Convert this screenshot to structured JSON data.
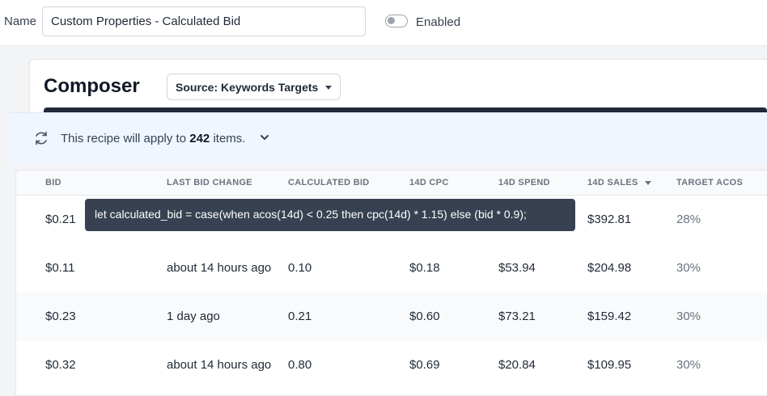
{
  "header": {
    "name_label": "Name",
    "name_value": "Custom Properties - Calculated Bid",
    "enabled_label": "Enabled",
    "enabled": false
  },
  "composer": {
    "title": "Composer",
    "source_label": "Source: Keywords Targets"
  },
  "banner": {
    "prefix": "This recipe will apply to",
    "count": "242",
    "suffix": "items."
  },
  "table": {
    "columns": [
      "BID",
      "LAST BID CHANGE",
      "CALCULATED BID",
      "14D CPC",
      "14D SPEND",
      "14D SALES",
      "TARGET ACOS"
    ],
    "sorted_column": "14D SALES",
    "rows": [
      {
        "bid": "$0.21",
        "last_change": "",
        "calc_bid": "",
        "cpc": "",
        "spend": "",
        "sales": "$392.81",
        "acos": "28%"
      },
      {
        "bid": "$0.11",
        "last_change": "about 14 hours ago",
        "calc_bid": "0.10",
        "cpc": "$0.18",
        "spend": "$53.94",
        "sales": "$204.98",
        "acos": "30%"
      },
      {
        "bid": "$0.23",
        "last_change": "1 day ago",
        "calc_bid": "0.21",
        "cpc": "$0.60",
        "spend": "$73.21",
        "sales": "$159.42",
        "acos": "30%"
      },
      {
        "bid": "$0.32",
        "last_change": "about 14 hours ago",
        "calc_bid": "0.80",
        "cpc": "$0.69",
        "spend": "$20.84",
        "sales": "$109.95",
        "acos": "30%"
      }
    ]
  },
  "tooltip": {
    "text": "let calculated_bid = case(when acos(14d) < 0.25 then cpc(14d) * 1.15) else (bid * 0.9);"
  },
  "icons": {
    "refresh": "refresh-icon",
    "chevron": "chevron-down-icon",
    "source_caret": "caret-down-icon",
    "sort_caret": "sort-desc-icon"
  }
}
